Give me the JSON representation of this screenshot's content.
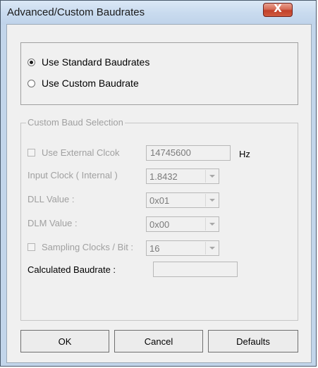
{
  "window": {
    "title": "Advanced/Custom Baudrates",
    "close_label": "X"
  },
  "baud_mode": {
    "options": [
      {
        "label": "Use Standard Baudrates",
        "selected": true
      },
      {
        "label": "Use Custom Baudrate",
        "selected": false
      }
    ]
  },
  "custom": {
    "legend": "Custom Baud Selection",
    "external_clock": {
      "label": "Use External Clcok",
      "checked": false,
      "value": "14745600",
      "unit": "Hz"
    },
    "input_clock": {
      "label": "Input Clock ( Internal )",
      "value": "1.8432"
    },
    "dll": {
      "label": "DLL Value :",
      "value": "0x01"
    },
    "dlm": {
      "label": "DLM Value :",
      "value": "0x00"
    },
    "sampling": {
      "label": "Sampling Clocks / Bit :",
      "checked": false,
      "value": "16"
    },
    "calculated": {
      "label": "Calculated Baudrate :",
      "value": ""
    }
  },
  "buttons": {
    "ok": "OK",
    "cancel": "Cancel",
    "defaults": "Defaults"
  }
}
